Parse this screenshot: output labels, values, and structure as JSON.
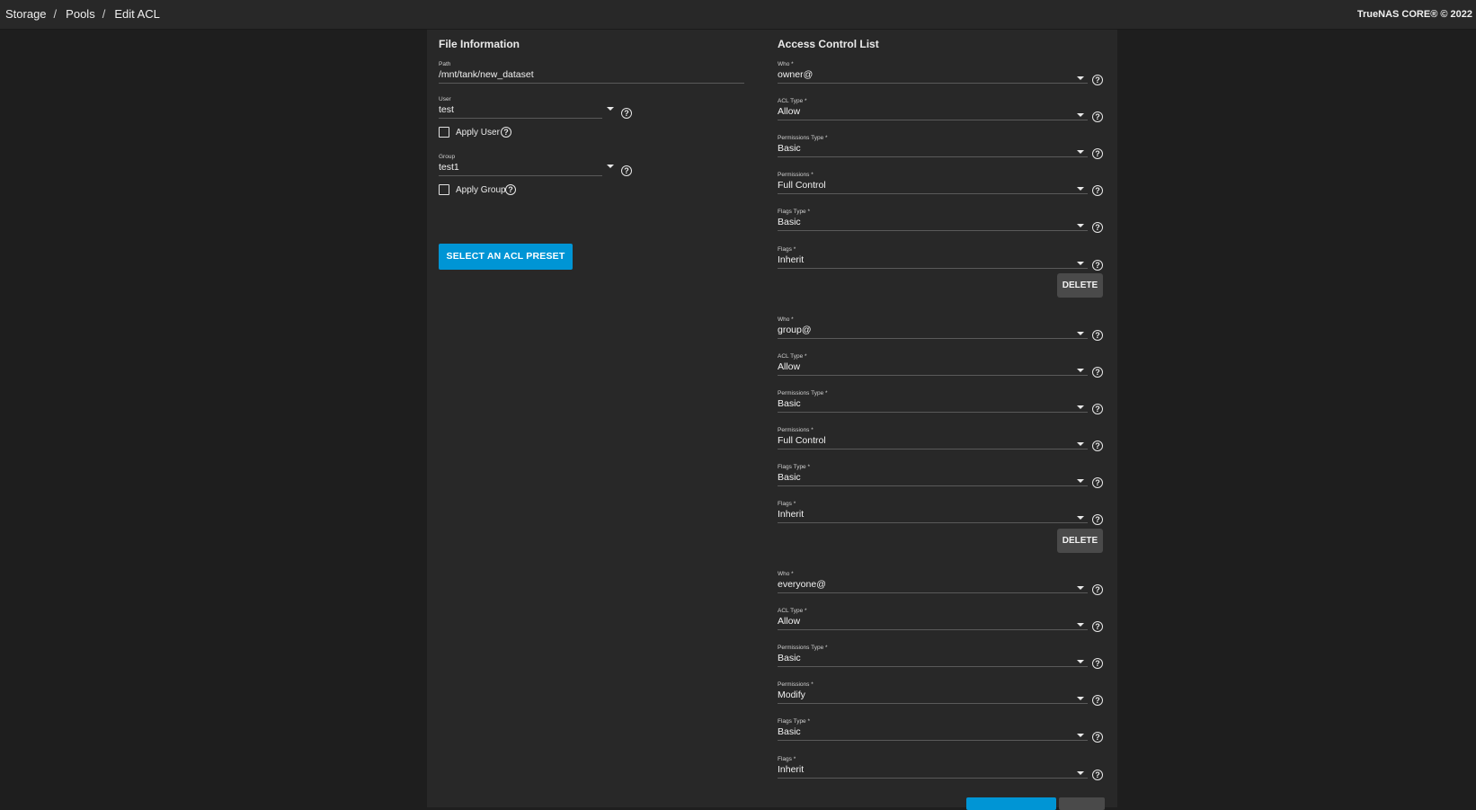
{
  "breadcrumbs": [
    "Storage",
    "Pools",
    "Edit ACL"
  ],
  "copyright": "TrueNAS CORE® © 2022",
  "file_info": {
    "title": "File Information",
    "path_label": "Path",
    "path_value": "/mnt/tank/new_dataset",
    "user_label": "User",
    "user_value": "test",
    "apply_user_label": "Apply User",
    "group_label": "Group",
    "group_value": "test1",
    "apply_group_label": "Apply Group",
    "preset_button": "SELECT AN ACL PRESET"
  },
  "acl": {
    "title": "Access Control List",
    "labels": {
      "who": "Who *",
      "acl_type": "ACL Type *",
      "perm_type": "Permissions Type *",
      "permissions": "Permissions *",
      "flags_type": "Flags Type *",
      "flags": "Flags *"
    },
    "delete_label": "DELETE",
    "entries": [
      {
        "who": "owner@",
        "acl_type": "Allow",
        "perm_type": "Basic",
        "permissions": "Full Control",
        "flags_type": "Basic",
        "flags": "Inherit"
      },
      {
        "who": "group@",
        "acl_type": "Allow",
        "perm_type": "Basic",
        "permissions": "Full Control",
        "flags_type": "Basic",
        "flags": "Inherit"
      },
      {
        "who": "everyone@",
        "acl_type": "Allow",
        "perm_type": "Basic",
        "permissions": "Modify",
        "flags_type": "Basic",
        "flags": "Inherit"
      }
    ]
  },
  "icons": {
    "help": "help-circle-icon",
    "dropdown": "caret-down-icon",
    "checkbox": "checkbox-unchecked-icon"
  },
  "colors": {
    "accent": "#0095d5",
    "background": "#1e1e1e",
    "card": "#282828"
  }
}
